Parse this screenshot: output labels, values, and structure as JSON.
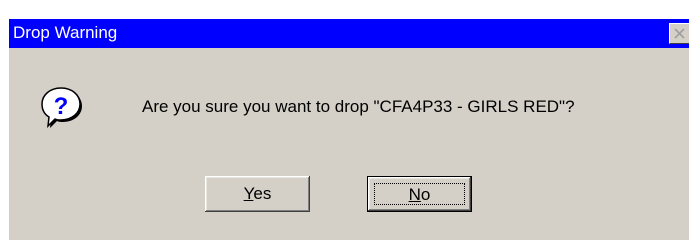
{
  "window": {
    "title": "Drop Warning",
    "close_icon": "close-icon"
  },
  "dialog": {
    "icon": "question-icon",
    "message": "Are you sure you want to drop \"CFA4P33 - GIRLS RED\"?"
  },
  "buttons": {
    "yes": {
      "accel": "Y",
      "rest": "es"
    },
    "no": {
      "accel": "N",
      "rest": "o"
    }
  },
  "colors": {
    "titlebar": "#0000ff",
    "face": "#d4d0c8",
    "title_text": "#ffffff"
  }
}
